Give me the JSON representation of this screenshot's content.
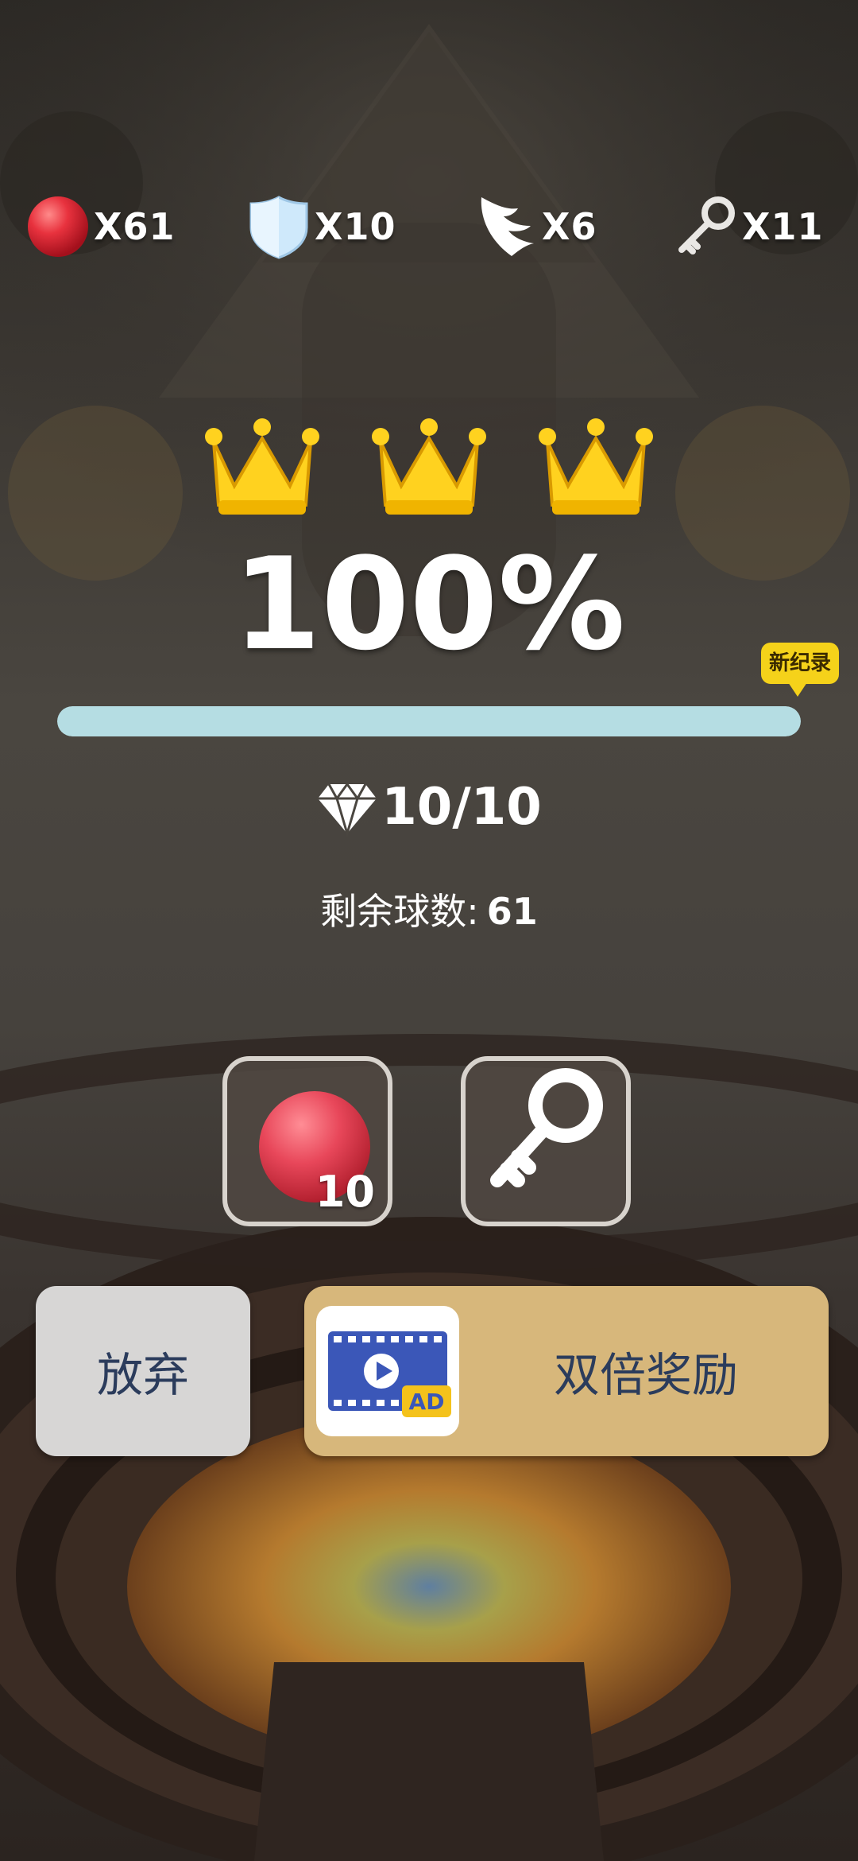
{
  "resources": {
    "balls": "X61",
    "shields": "X10",
    "wings": "X6",
    "keys": "X11"
  },
  "result": {
    "crowns_earned": 3,
    "crowns_total": 3,
    "percent": "100%",
    "new_record_badge": "新纪录",
    "progress": 1.0,
    "gems": "10/10",
    "remaining_label": "剩余球数:",
    "remaining_value": "61"
  },
  "rewards": {
    "ball_quantity": "10"
  },
  "buttons": {
    "give_up": "放弃",
    "double_reward": "双倍奖励",
    "ad_label": "AD"
  },
  "colors": {
    "progress_fill": "#b5dde3",
    "crown": "#ffd21f",
    "give_up_bg": "#d7d6d5",
    "double_bg": "#d7b77b",
    "button_text": "#2b3c5c",
    "ball_red": "#e8323e",
    "new_record": "#f5d21a"
  },
  "icons": {
    "ball": "red-ball-icon",
    "shield": "shield-icon",
    "wing": "wing-icon",
    "key": "key-icon",
    "crown": "crown-icon",
    "gem": "diamond-icon",
    "video_ad": "video-ad-icon"
  }
}
